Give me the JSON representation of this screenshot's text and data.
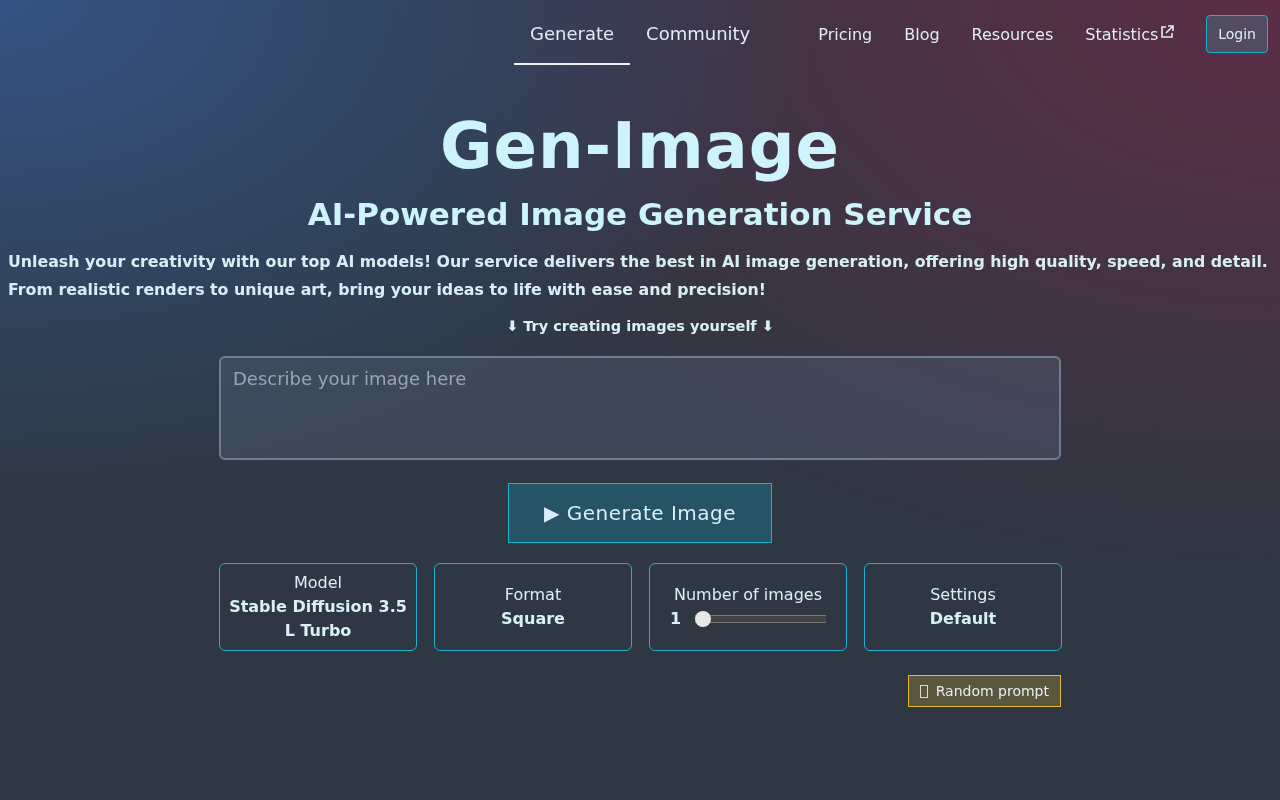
{
  "nav": {
    "tabs": [
      {
        "label": "Generate",
        "selected": true
      },
      {
        "label": "Community",
        "selected": false
      }
    ],
    "links": [
      {
        "label": "Pricing",
        "external": false
      },
      {
        "label": "Blog",
        "external": false
      },
      {
        "label": "Resources",
        "external": false
      },
      {
        "label": "Statistics",
        "external": true
      }
    ],
    "login": "Login"
  },
  "hero": {
    "title": "Gen-Image",
    "subtitle": "AI-Powered Image Generation Service",
    "description": "Unleash your creativity with our top AI models! Our service delivers the best in AI image generation, offering high quality, speed, and detail. From realistic renders to unique art, bring your ideas to life with ease and precision!",
    "cta_hint": "⬇ Try creating images yourself ⬇"
  },
  "prompt": {
    "placeholder": "Describe your image here"
  },
  "generate_button": "▶ Generate Image",
  "options": [
    {
      "kind": "text",
      "label": "Model",
      "value": "Stable Diffusion 3.5 L Turbo"
    },
    {
      "kind": "text",
      "label": "Format",
      "value": "Square"
    },
    {
      "kind": "slider",
      "label": "Number of images",
      "value": "1",
      "level": 0
    },
    {
      "kind": "text",
      "label": "Settings",
      "value": "Default"
    }
  ],
  "random_prompt": "Random prompt"
}
